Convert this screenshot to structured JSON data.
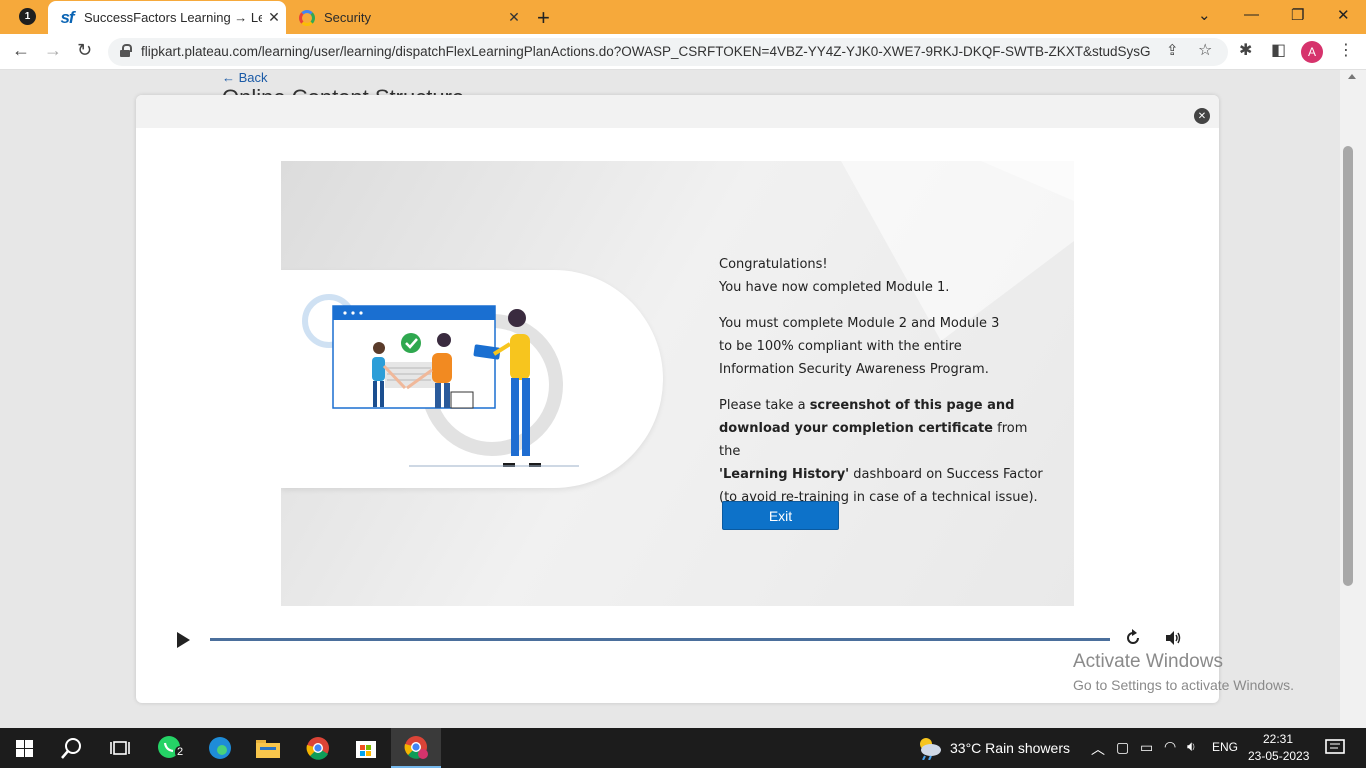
{
  "browser": {
    "tab_count_badge": "1",
    "tabs": [
      {
        "title": "SuccessFactors Learning → Learn",
        "favicon": "sf"
      },
      {
        "title": "Security",
        "favicon": "G"
      }
    ],
    "url": "flipkart.plateau.com/learning/user/learning/dispatchFlexLearningPlanActions.do?OWASP_CSRFTOKEN=4VBZ-YY4Z-YJK0-XWE7-9RKJ-DKQF-SWTB-ZKXT&studSysG...",
    "profile_initial": "A",
    "colors": {
      "tab_strip": "#f6a93b",
      "accent": "#0d72c9"
    }
  },
  "page": {
    "back_label": "← Back",
    "heading": "Online Content Structure"
  },
  "slide": {
    "congrats": "Congratulations!",
    "completed": "You have now completed Module 1.",
    "must_line1": "You must complete Module 2 and Module 3",
    "must_line2": "to be 100% compliant with the entire",
    "must_line3": "Information Security Awareness Program.",
    "take_prefix": "Please take a ",
    "take_bold1": "screenshot of this page and",
    "take_bold2": "download your completion certificate",
    "take_from": " from the",
    "history_bold": "'Learning History'",
    "history_rest": " dashboard on Success Factor",
    "avoid": "(to avoid re-training in case of a technical issue).",
    "exit_label": "Exit"
  },
  "player": {
    "progress": 1.0
  },
  "watermark": {
    "line1": "Activate Windows",
    "line2": "Go to Settings to activate Windows."
  },
  "taskbar": {
    "whatsapp_badge": "2",
    "weather": "33°C  Rain showers",
    "language": "ENG",
    "time": "22:31",
    "date": "23-05-2023"
  }
}
